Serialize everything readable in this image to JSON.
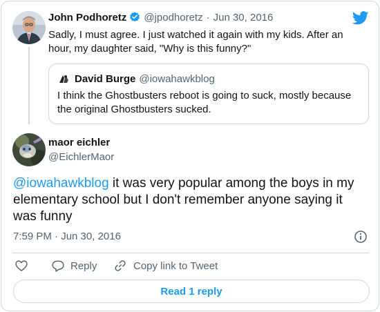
{
  "parent": {
    "author_name": "John Podhoretz",
    "handle": "@jpodhoretz",
    "separator": "·",
    "date": "Jun 30, 2016",
    "text": "Sadly, I must agree. I just watched it again with my kids. After an hour, my daughter said, \"Why is this funny?\""
  },
  "quoted": {
    "author_name": "David Burge",
    "handle": "@iowahawkblog",
    "text": "I think the Ghostbusters reboot is going to suck, mostly because the original Ghostbusters sucked."
  },
  "main": {
    "author_name": "maor eichler",
    "handle": "@EichlerMaor",
    "mention": "@iowahawkblog",
    "text": " it was very popular among the boys in my elementary school but I don't remember anyone saying it was funny",
    "timestamp": "7:59 PM · Jun 30, 2016"
  },
  "actions": {
    "reply_label": "Reply",
    "copy_link_label": "Copy link to Tweet"
  },
  "read_reply_label": "Read 1 reply",
  "colors": {
    "accent": "#1d9bf0",
    "border": "#cfd9de",
    "muted_text": "#536471"
  },
  "icons": {
    "brand": "twitter-bird-icon",
    "verified": "verified-badge-icon",
    "info": "info-icon",
    "like": "heart-icon",
    "reply": "reply-bubble-icon",
    "copy_link": "link-icon"
  }
}
